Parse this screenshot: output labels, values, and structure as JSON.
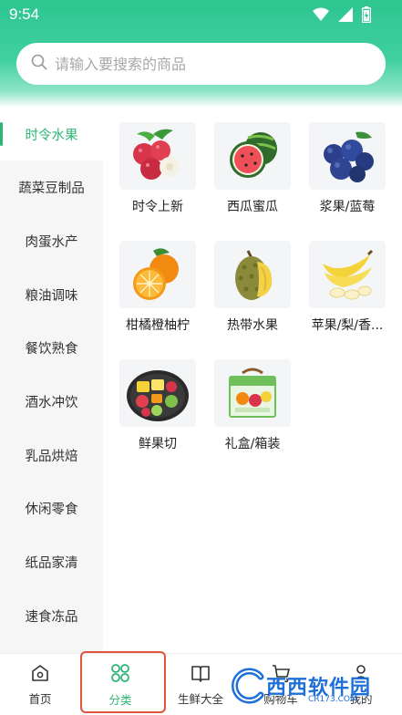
{
  "status_bar": {
    "time": "9:54"
  },
  "search": {
    "placeholder": "请输入要搜索的商品"
  },
  "sidebar": {
    "items": [
      {
        "label": "时令水果",
        "active": true
      },
      {
        "label": "蔬菜豆制品"
      },
      {
        "label": "肉蛋水产"
      },
      {
        "label": "粮油调味"
      },
      {
        "label": "餐饮熟食"
      },
      {
        "label": "酒水冲饮"
      },
      {
        "label": "乳品烘焙"
      },
      {
        "label": "休闲零食"
      },
      {
        "label": "纸品家清"
      },
      {
        "label": "速食冻品"
      }
    ]
  },
  "categories": [
    {
      "label": "时令上新",
      "icon": "lychee-icon"
    },
    {
      "label": "西瓜蜜瓜",
      "icon": "watermelon-icon"
    },
    {
      "label": "浆果/蓝莓",
      "icon": "blueberry-icon"
    },
    {
      "label": "柑橘橙柚柠",
      "icon": "orange-icon"
    },
    {
      "label": "热带水果",
      "icon": "durian-icon"
    },
    {
      "label": "苹果/梨/香...",
      "icon": "banana-icon"
    },
    {
      "label": "鲜果切",
      "icon": "fruit-platter-icon"
    },
    {
      "label": "礼盒/箱装",
      "icon": "gift-box-icon"
    }
  ],
  "tabbar": {
    "tabs": [
      {
        "label": "首页",
        "icon": "home-icon"
      },
      {
        "label": "分类",
        "icon": "category-icon",
        "active": true
      },
      {
        "label": "生鲜大全",
        "icon": "book-icon"
      },
      {
        "label": "购物车",
        "icon": "cart-icon"
      },
      {
        "label": "我的",
        "icon": "user-icon"
      }
    ]
  },
  "watermark": {
    "text": "西西软件园",
    "sub": "CR173.COM"
  },
  "colors": {
    "accent": "#2bb673",
    "header_top": "#2ec590",
    "highlight_box": "#e0553b"
  }
}
